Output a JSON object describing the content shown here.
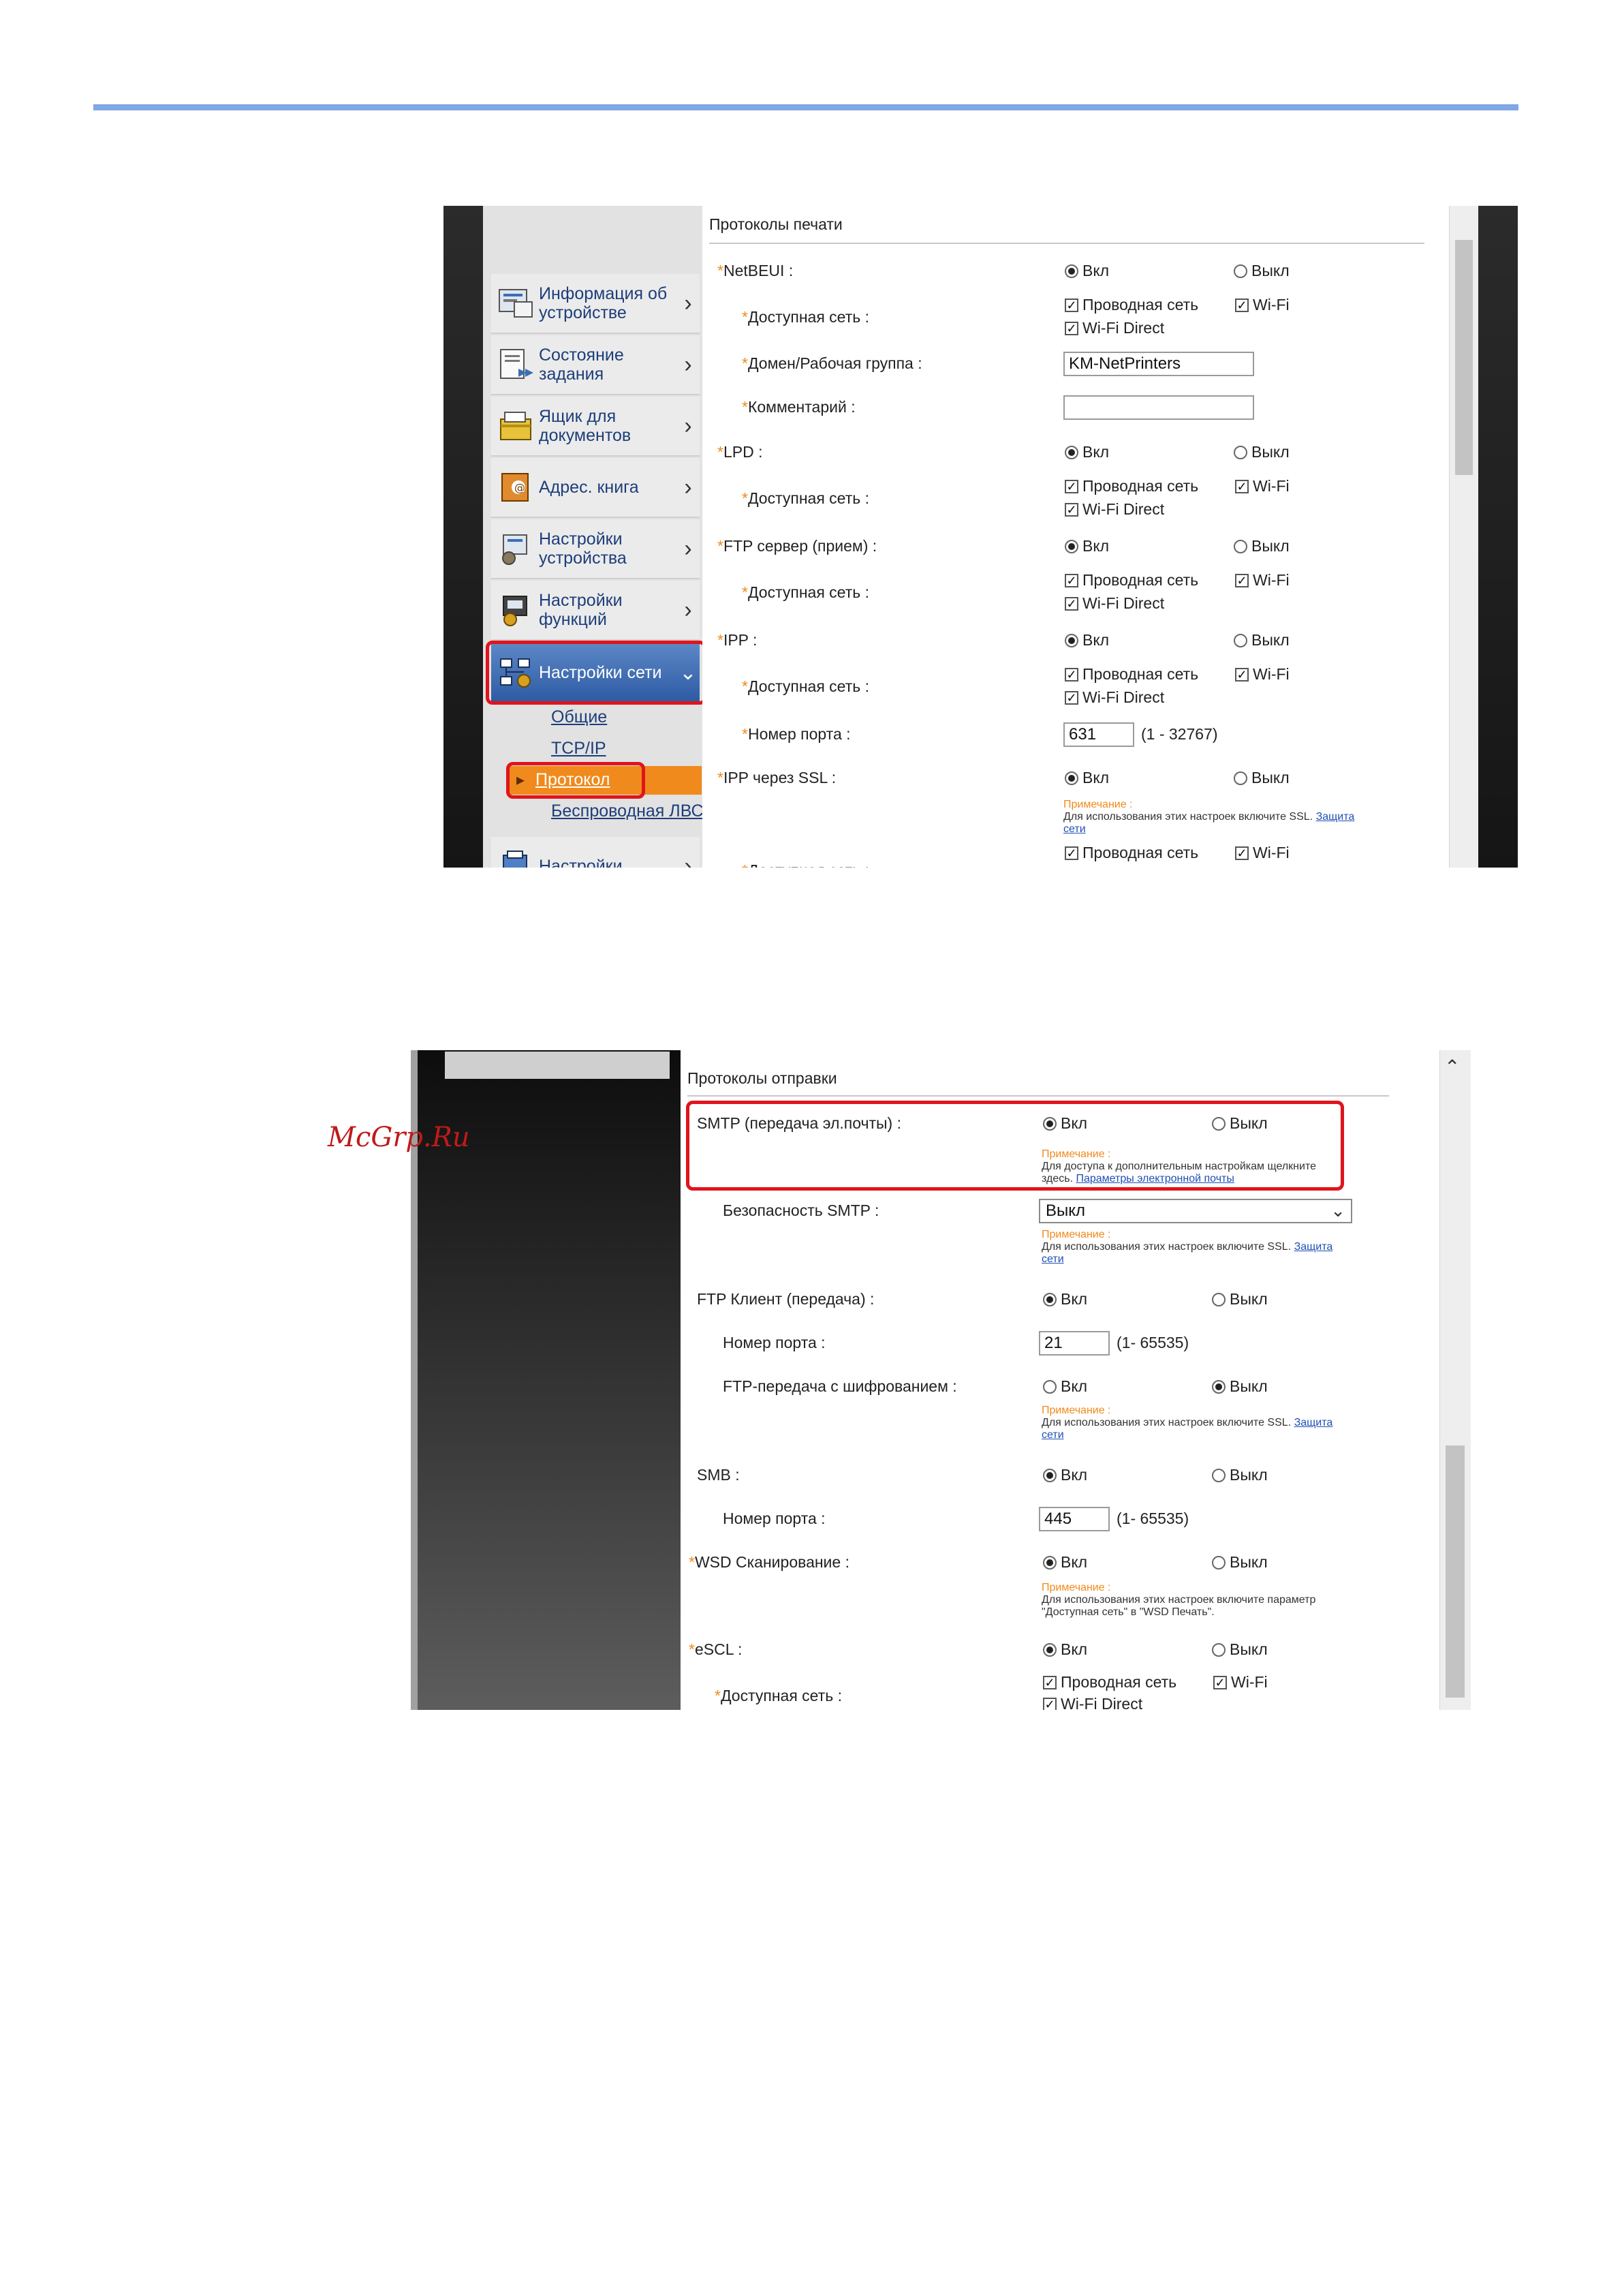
{
  "screenshot1": {
    "sidebar": {
      "items": [
        {
          "label": "Информация об устройстве",
          "icon": "device-info-icon"
        },
        {
          "label": "Состояние задания",
          "icon": "job-status-icon"
        },
        {
          "label": "Ящик для документов",
          "icon": "document-box-icon"
        },
        {
          "label": "Адрес. книга",
          "icon": "address-book-icon"
        },
        {
          "label": "Настройки устройства",
          "icon": "device-settings-icon"
        },
        {
          "label": "Настройки функций",
          "icon": "function-settings-icon"
        },
        {
          "label": "Настройки сети",
          "icon": "network-settings-icon"
        },
        {
          "label": "Настройки",
          "icon": "security-settings-icon"
        }
      ],
      "sub_items": [
        "Общие",
        "TCP/IP",
        "Протокол",
        "Беспроводная ЛВС"
      ]
    },
    "section_title": "Протоколы печати",
    "on_label": "Вкл",
    "off_label": "Выкл",
    "wired_label": "Проводная сеть",
    "wifi_label": "Wi-Fi",
    "wifidirect_label": "Wi-Fi Direct",
    "rows": {
      "netbeui": "NetBEUI :",
      "avail_net": "Доступная сеть :",
      "domain": "Домен/Рабочая группа :",
      "domain_value": "KM-NetPrinters",
      "comment": "Комментарий :",
      "lpd": "LPD :",
      "ftp_server": "FTP сервер (прием) :",
      "ipp": "IPP :",
      "port_number": "Номер порта :",
      "port_value": "631",
      "port_range": "(1 - 32767)",
      "ipp_ssl": "IPP через SSL :",
      "avail_net_cut": "Доступная сеть :"
    },
    "ssl_note": {
      "note": "Примечание :",
      "text": "Для использования этих настроек включите SSL.",
      "link1": "Защита",
      "link2": "сети"
    }
  },
  "screenshot2": {
    "section_title": "Протоколы отправки",
    "on_label": "Вкл",
    "off_label": "Выкл",
    "smtp": "SMTP (передача эл.почты) :",
    "smtp_note": {
      "note": "Примечание :",
      "line1": "Для доступа к дополнительным настройкам щелкните",
      "line2": "здесь.",
      "link": "Параметры электронной почты"
    },
    "smtp_security": "Безопасность SMTP :",
    "smtp_security_value": "Выкл",
    "ssl_note": {
      "note": "Примечание :",
      "text": "Для использования этих настроек включите SSL.",
      "link1": "Защита",
      "link2": "сети"
    },
    "ftp_client": "FTP Клиент (передача) :",
    "port_number": "Номер порта :",
    "ftp_port_value": "21",
    "port_range": "(1- 65535)",
    "ftp_encrypt": "FTP-передача с шифрованием :",
    "smb": "SMB :",
    "smb_port_value": "445",
    "wsd_scan": "WSD Сканирование :",
    "wsd_note": {
      "note": "Примечание :",
      "line1": "Для использования этих настроек включите параметр",
      "line2": "\"Доступная сеть\" в \"WSD Печать\"."
    },
    "escl": "eSCL :",
    "avail_net": "Доступная сеть :",
    "wired_label": "Проводная сеть",
    "wifi_label": "Wi-Fi",
    "wifidirect_label": "Wi-Fi Direct"
  },
  "watermark": "McGrp.Ru",
  "colors": {
    "accent_rule": "#7fa8e4",
    "highlight": "#e0141c",
    "required_mark": "#f08a1c",
    "link": "#1f4fb5"
  }
}
